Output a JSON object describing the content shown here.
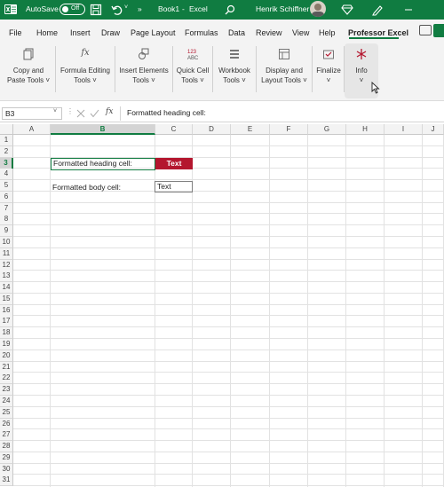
{
  "titlebar": {
    "autosave_label": "AutoSave",
    "autosave_state": "Off",
    "more_label": "»",
    "book_title": "Book1",
    "separator": "-",
    "app_name": "Excel",
    "user_name": "Henrik Schiffner",
    "background_color": "#107c41"
  },
  "menu": {
    "tabs": [
      "File",
      "Home",
      "Insert",
      "Draw",
      "Page Layout",
      "Formulas",
      "Data",
      "Review",
      "View",
      "Help",
      "Professor Excel"
    ],
    "active_tab": "Professor Excel"
  },
  "ribbon": {
    "groups": [
      {
        "line1": "Copy and",
        "line2": "Paste Tools ˅",
        "icon": "copy-icon"
      },
      {
        "line1": "Formula Editing",
        "line2": "Tools ˅",
        "icon": "fx-icon"
      },
      {
        "line1": "Insert Elements",
        "line2": "Tools ˅",
        "icon": "shapes-icon"
      },
      {
        "line1": "Quick Cell",
        "line2": "Tools ˅",
        "icon": "number-format-icon"
      },
      {
        "line1": "Workbook",
        "line2": "Tools ˅",
        "icon": "workbook-icon"
      },
      {
        "line1": "Display and",
        "line2": "Layout Tools ˅",
        "icon": "layout-icon"
      },
      {
        "line1": "Finalize",
        "line2": "˅",
        "icon": "finalize-icon"
      },
      {
        "line1": "Info",
        "line2": "˅",
        "icon": "info-icon"
      }
    ]
  },
  "formula_bar": {
    "name_box": "B3",
    "fx_label": "fx",
    "content": "Formatted heading cell:"
  },
  "sheet": {
    "columns": [
      "A",
      "B",
      "C",
      "D",
      "E",
      "F",
      "G",
      "H",
      "I",
      "J"
    ],
    "rows": [
      "1",
      "2",
      "3",
      "4",
      "5",
      "6",
      "7",
      "8",
      "9",
      "10",
      "11",
      "12",
      "13",
      "14",
      "15",
      "16",
      "17",
      "18",
      "19",
      "20",
      "21",
      "22",
      "23",
      "24",
      "25",
      "26",
      "27",
      "28",
      "29",
      "30",
      "31"
    ],
    "selected_column": "B",
    "selected_row": "3",
    "cells": {
      "b3": "Formatted heading cell:",
      "c3": "Text",
      "b5": "Formatted body cell:",
      "c5": "Text"
    },
    "heading_fill_color": "#b4162e",
    "accent_color": "#107c41"
  }
}
